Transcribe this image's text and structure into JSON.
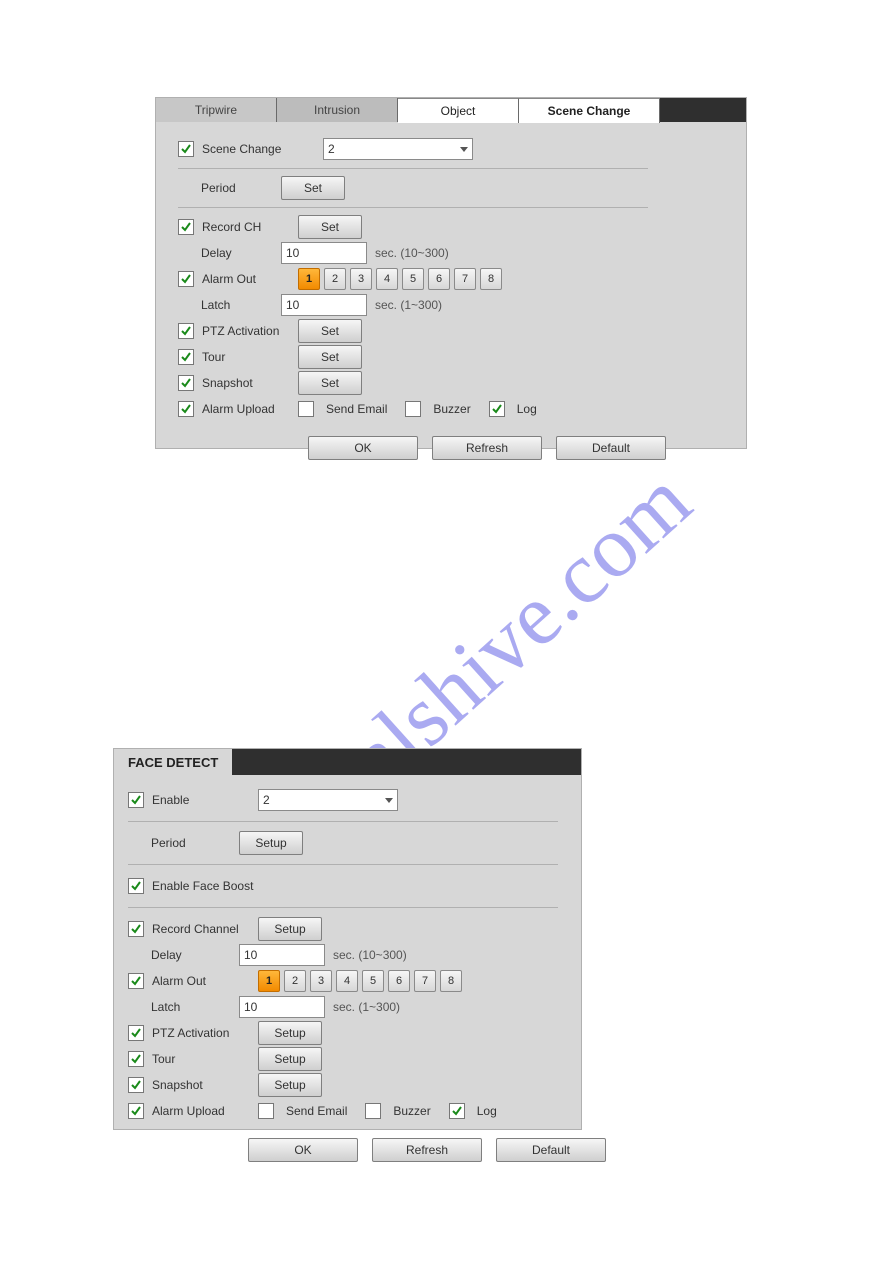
{
  "watermark": "manualshive.com",
  "panel1": {
    "tabs": {
      "tripwire": "Tripwire",
      "intrusion": "Intrusion",
      "object": "Object",
      "scene": "Scene Change"
    },
    "scene_change": {
      "label": "Scene Change",
      "select_value": "2"
    },
    "period": {
      "label": "Period",
      "btn": "Set"
    },
    "record": {
      "label": "Record CH",
      "btn": "Set"
    },
    "delay": {
      "label": "Delay",
      "value": "10",
      "hint": "sec. (10~300)"
    },
    "alarm_out": {
      "label": "Alarm Out",
      "ch": [
        "1",
        "2",
        "3",
        "4",
        "5",
        "6",
        "7",
        "8"
      ]
    },
    "latch": {
      "label": "Latch",
      "value": "10",
      "hint": "sec. (1~300)"
    },
    "ptz": {
      "label": "PTZ Activation",
      "btn": "Set"
    },
    "tour": {
      "label": "Tour",
      "btn": "Set"
    },
    "snapshot": {
      "label": "Snapshot",
      "btn": "Set"
    },
    "upload": {
      "label": "Alarm Upload",
      "send_email": "Send Email",
      "buzzer": "Buzzer",
      "log": "Log"
    },
    "buttons": {
      "ok": "OK",
      "refresh": "Refresh",
      "default": "Default"
    }
  },
  "panel2": {
    "title": "FACE DETECT",
    "enable": {
      "label": "Enable",
      "select_value": "2"
    },
    "period": {
      "label": "Period",
      "btn": "Setup"
    },
    "face_boost": {
      "label": "Enable Face Boost"
    },
    "record": {
      "label": "Record Channel",
      "btn": "Setup"
    },
    "delay": {
      "label": "Delay",
      "value": "10",
      "hint": "sec. (10~300)"
    },
    "alarm_out": {
      "label": "Alarm Out",
      "ch": [
        "1",
        "2",
        "3",
        "4",
        "5",
        "6",
        "7",
        "8"
      ]
    },
    "latch": {
      "label": "Latch",
      "value": "10",
      "hint": "sec. (1~300)"
    },
    "ptz": {
      "label": "PTZ Activation",
      "btn": "Setup"
    },
    "tour": {
      "label": "Tour",
      "btn": "Setup"
    },
    "snapshot": {
      "label": "Snapshot",
      "btn": "Setup"
    },
    "upload": {
      "label": "Alarm Upload",
      "send_email": "Send Email",
      "buzzer": "Buzzer",
      "log": "Log"
    },
    "buttons": {
      "ok": "OK",
      "refresh": "Refresh",
      "default": "Default"
    }
  }
}
